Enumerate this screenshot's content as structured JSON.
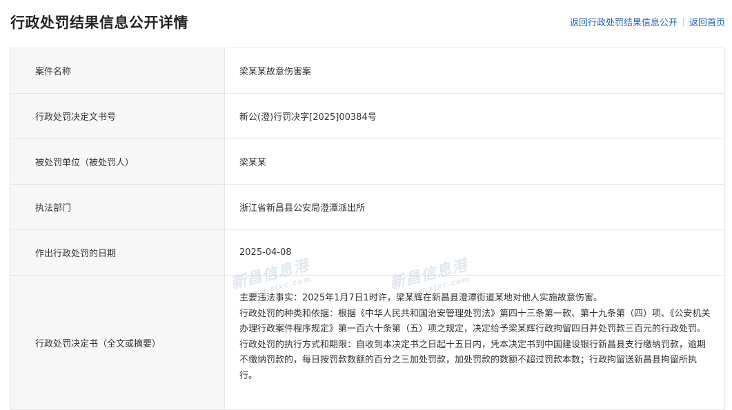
{
  "header": {
    "title": "行政处罚结果信息公开详情",
    "link_back_list": "返回行政处罚结果信息公开",
    "link_home": "返回首页"
  },
  "rows": [
    {
      "label": "案件名称",
      "value": "梁某某故意伤害案"
    },
    {
      "label": "行政处罚决定文书号",
      "value": "新公(澄)行罚决字[2025]00384号"
    },
    {
      "label": "被处罚单位（被处罚人）",
      "value": "梁某某"
    },
    {
      "label": "执法部门",
      "value": "浙江省新昌县公安局澄潭派出所"
    },
    {
      "label": "作出行政处罚的日期",
      "value": "2025-04-08"
    }
  ],
  "decision": {
    "label": "行政处罚决定书（全文或摘要）",
    "paragraphs": [
      "主要违法事实：2025年1月7日1时许，梁某辉在新昌县澄潭街道某地对他人实施故意伤害。",
      "行政处罚的种类和依据：根据《中华人民共和国治安管理处罚法》第四十三条第一款、第十九条第（四）项、《公安机关办理行政案件程序规定》第一百六十条第（五）项之规定，决定给予梁某辉行政拘留四日并处罚款三百元的行政处罚。",
      "行政处罚的执行方式和期限：自收到本决定书之日起十五日内，凭本决定书到中国建设银行新昌县支行缴纳罚款，逾期不缴纳罚款的，每日按罚款数额的百分之三加处罚款，加处罚款的数额不超过罚款本数；行政拘留送新昌县拘留所执行。"
    ]
  },
  "watermark": {
    "text": "新昌信息港",
    "url": "www.xjxc.com"
  }
}
